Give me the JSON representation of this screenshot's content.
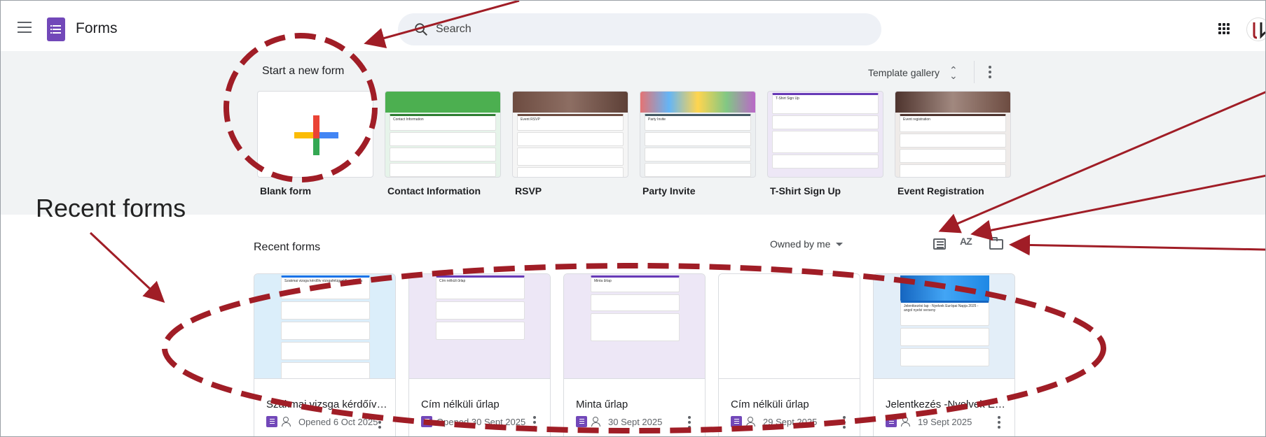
{
  "app": {
    "title": "Forms"
  },
  "search": {
    "placeholder": "Search"
  },
  "template_section": {
    "heading": "Start a new form",
    "gallery_label": "Template gallery",
    "templates": [
      {
        "label": "Blank form"
      },
      {
        "label": "Contact Information",
        "thumb_title": "Contact Information"
      },
      {
        "label": "RSVP",
        "thumb_title": "Event RSVP"
      },
      {
        "label": "Party Invite",
        "thumb_title": "Party Invite"
      },
      {
        "label": "T-Shirt Sign Up",
        "thumb_title": "T-Shirt Sign Up"
      },
      {
        "label": "Event Registration",
        "thumb_title": "Event registration"
      }
    ]
  },
  "recent_section": {
    "heading": "Recent forms",
    "owner_filter": "Owned by me",
    "sort_icon_text": "AZ",
    "forms": [
      {
        "title": "Szakmai vizsga kérdőív Vi...",
        "meta": "Opened 6 Oct 2025",
        "shared": true,
        "thumb_title": "Szakmai vizsga kérdőív vizsgafelügyelők számára"
      },
      {
        "title": "Cím nélküli űrlap",
        "meta": "Opened 30 Sept 2025",
        "shared": false,
        "thumb_title": "Cím nélküli űrlap"
      },
      {
        "title": "Minta űrlap",
        "meta": "30 Sept 2025",
        "shared": true,
        "thumb_title": "Minta űrlap"
      },
      {
        "title": "Cím nélküli űrlap",
        "meta": "29 Sept 2025",
        "shared": true,
        "thumb_title": ""
      },
      {
        "title": "Jelentkezés -Nyelvek Eur...",
        "meta": "19 Sept 2025",
        "shared": true,
        "thumb_title": "Jelentkezési lap - Nyelvek Európai Napja 2025 - angol nyelvi verseny"
      }
    ]
  },
  "annotation": {
    "label": "Recent forms",
    "color": "#a01d26"
  },
  "colors": {
    "forms_purple": "#7248b9",
    "template_bg": "#f1f3f4",
    "search_bg": "#eef1f6"
  }
}
